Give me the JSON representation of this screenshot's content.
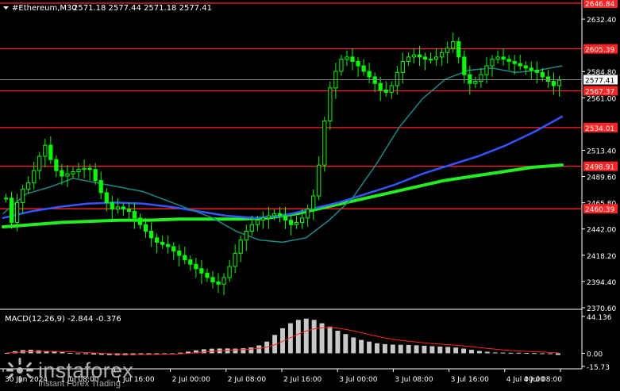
{
  "header": {
    "symbol": "#Ethereum,M30",
    "ohlc": "2571.18 2577.44 2571.18 2577.41"
  },
  "price_axis": {
    "min": 2370.6,
    "max": 2646.84,
    "labels": [
      "2632.40",
      "2584.80",
      "2561.00",
      "2513.40",
      "2489.60",
      "2465.80",
      "2442.00",
      "2418.20",
      "2394.40",
      "2370.60"
    ],
    "label_values": [
      2632.4,
      2584.8,
      2561.0,
      2513.4,
      2489.6,
      2465.8,
      2442.0,
      2418.2,
      2394.4,
      2370.6
    ],
    "current_price": "2577.41",
    "current_value": 2577.41
  },
  "levels": [
    {
      "label": "2646.84",
      "value": 2646.84,
      "color": "#ff2222"
    },
    {
      "label": "2605.39",
      "value": 2605.39,
      "color": "#ff2222"
    },
    {
      "label": "2567.37",
      "value": 2567.37,
      "color": "#ff2222"
    },
    {
      "label": "2534.01",
      "value": 2534.01,
      "color": "#ff2222"
    },
    {
      "label": "2498.91",
      "value": 2498.91,
      "color": "#ff2222"
    },
    {
      "label": "2460.39",
      "value": 2460.39,
      "color": "#ff2222"
    }
  ],
  "time_axis": {
    "labels": [
      "30 Jun 2024",
      "1 Jul 08:00",
      "1 Jul 16:00",
      "2 Jul 00:00",
      "2 Jul 08:00",
      "2 Jul 16:00",
      "3 Jul 00:00",
      "3 Jul 08:00",
      "3 Jul 16:00",
      "4 Jul 00:00",
      "4 Jul 08:00"
    ]
  },
  "macd": {
    "title": "MACD(12,26,9) -2.844 -0.376",
    "axis_labels": [
      "44.136",
      "0.00",
      "-15.73"
    ],
    "axis_values": [
      44.136,
      0.0,
      -15.73
    ],
    "min": -15.73,
    "max": 44.136
  },
  "watermark": {
    "name": "instaforex",
    "tagline": "Instant Forex Trading"
  },
  "colors": {
    "background": "#000000",
    "candle": "#00ff00",
    "level": "#ff2222",
    "ma_fast": "#1a8a8a",
    "ma_mid": "#3355ff",
    "ma_slow": "#22ee22",
    "macd_hist": "#c8c8c8",
    "macd_signal": "#ff2222",
    "axis_text": "#ffffff"
  },
  "chart_data": {
    "type": "candlestick",
    "timeframe": "M30",
    "symbol": "#Ethereum",
    "close_series": [
      2470,
      2448,
      2466,
      2478,
      2484,
      2495,
      2508,
      2518,
      2505,
      2495,
      2490,
      2492,
      2494,
      2496,
      2497,
      2496,
      2486,
      2475,
      2466,
      2460,
      2462,
      2460,
      2458,
      2452,
      2446,
      2440,
      2434,
      2430,
      2428,
      2426,
      2422,
      2418,
      2414,
      2410,
      2406,
      2402,
      2398,
      2394,
      2392,
      2398,
      2408,
      2420,
      2432,
      2440,
      2446,
      2450,
      2452,
      2454,
      2456,
      2454,
      2450,
      2446,
      2448,
      2452,
      2460,
      2472,
      2500,
      2540,
      2570,
      2585,
      2596,
      2598,
      2594,
      2590,
      2585,
      2580,
      2574,
      2568,
      2566,
      2572,
      2584,
      2594,
      2598,
      2600,
      2598,
      2596,
      2596,
      2598,
      2602,
      2606,
      2612,
      2598,
      2582,
      2574,
      2576,
      2582,
      2590,
      2596,
      2598,
      2596,
      2594,
      2592,
      2590,
      2588,
      2586,
      2584,
      2580,
      2576,
      2572,
      2577
    ],
    "ma_fast_series": [
      2456,
      2474,
      2480,
      2488,
      2484,
      2480,
      2476,
      2468,
      2460,
      2452,
      2440,
      2432,
      2430,
      2434,
      2450,
      2470,
      2500,
      2534,
      2560,
      2578,
      2586,
      2588,
      2584,
      2586,
      2590
    ],
    "ma_mid_series": [
      2452,
      2458,
      2462,
      2465,
      2466,
      2465,
      2462,
      2458,
      2454,
      2452,
      2454,
      2460,
      2466,
      2474,
      2482,
      2492,
      2500,
      2508,
      2518,
      2530,
      2544
    ],
    "ma_slow_series": [
      2444,
      2446,
      2448,
      2449,
      2450,
      2450,
      2451,
      2451,
      2451,
      2452,
      2456,
      2462,
      2468,
      2474,
      2480,
      2486,
      2490,
      2494,
      2498,
      2500
    ],
    "macd_hist_series": [
      0.5,
      2.5,
      3.8,
      4.2,
      3.6,
      2.8,
      2.0,
      1.4,
      0.4,
      -0.4,
      -1.0,
      -1.5,
      -1.8,
      -2.2,
      -2.5,
      -2.4,
      -2.2,
      -1.8,
      -1.5,
      -1.1,
      -0.6,
      0.0,
      0.8,
      2.0,
      3.5,
      4.8,
      5.5,
      5.7,
      5.8,
      5.6,
      6.0,
      7.0,
      9.5,
      14.0,
      22.0,
      30.0,
      36.0,
      40.0,
      41.5,
      40.0,
      36.0,
      32.0,
      27.0,
      23.0,
      19.0,
      16.0,
      14.0,
      12.0,
      11.0,
      10.4,
      10.2,
      10.0,
      9.6,
      9.0,
      8.5,
      8.0,
      7.6,
      6.8,
      5.6,
      4.2,
      2.8,
      1.8,
      1.0,
      0.8,
      0.6,
      0.6,
      0.4,
      0.2,
      -0.2,
      -1.0,
      -2.0
    ]
  }
}
